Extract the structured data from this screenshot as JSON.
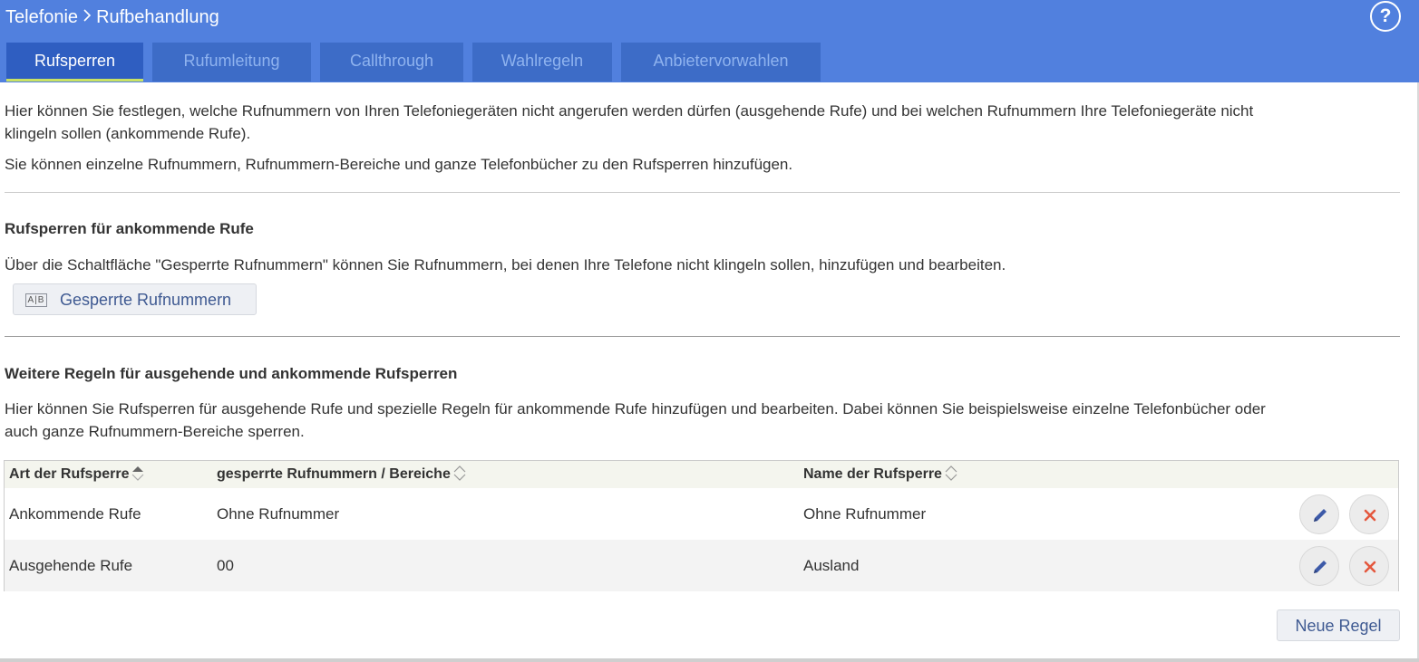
{
  "header": {
    "breadcrumb": [
      "Telefonie",
      "Rufbehandlung"
    ],
    "help_label": "?"
  },
  "tabs": [
    {
      "label": "Rufsperren",
      "active": true
    },
    {
      "label": "Rufumleitung",
      "active": false
    },
    {
      "label": "Callthrough",
      "active": false
    },
    {
      "label": "Wahlregeln",
      "active": false
    },
    {
      "label": "Anbietervorwahlen",
      "active": false
    }
  ],
  "intro": {
    "line1": "Hier können Sie festlegen, welche Rufnummern von Ihren Telefoniegeräten nicht angerufen werden dürfen (ausgehende Rufe) und bei welchen Rufnummern Ihre Telefoniegeräte nicht",
    "line2": "klingeln sollen (ankommende Rufe).",
    "line3": "Sie können einzelne Rufnummern, Rufnummern-Bereiche und ganze Telefonbücher zu den Rufsperren hinzufügen."
  },
  "incoming": {
    "heading": "Rufsperren für ankommende Rufe",
    "description": "Über die Schaltfläche \"Gesperrte Rufnummern\" können Sie Rufnummern, bei denen Ihre Telefone nicht klingeln sollen, hinzufügen und bearbeiten.",
    "button_label": "Gesperrte Rufnummern",
    "button_icon": "address-book-icon",
    "button_icon_text": "A|B"
  },
  "rules": {
    "heading": "Weitere Regeln für ausgehende und ankommende Rufsperren",
    "description_line1": "Hier können Sie Rufsperren für ausgehende Rufe und spezielle Regeln für ankommende Rufe hinzufügen und bearbeiten. Dabei können Sie beispielsweise einzelne Telefonbücher oder",
    "description_line2": "auch ganze Rufnummern-Bereiche sperren.",
    "columns": [
      "Art der Rufsperre",
      "gesperrte Rufnummern / Bereiche",
      "Name der Rufsperre"
    ],
    "rows": [
      {
        "type": "Ankommende Rufe",
        "numbers": "Ohne Rufnummer",
        "name": "Ohne Rufnummer"
      },
      {
        "type": "Ausgehende Rufe",
        "numbers": "00",
        "name": "Ausland"
      }
    ],
    "new_rule_label": "Neue Regel"
  },
  "colors": {
    "header_bg": "#5180de",
    "tab_bg": "#3d6cc7",
    "tab_active_bg": "#2f5ec1",
    "tab_active_underline": "#c9e264",
    "edit_icon": "#3d5aa8",
    "delete_icon": "#e4573d"
  }
}
